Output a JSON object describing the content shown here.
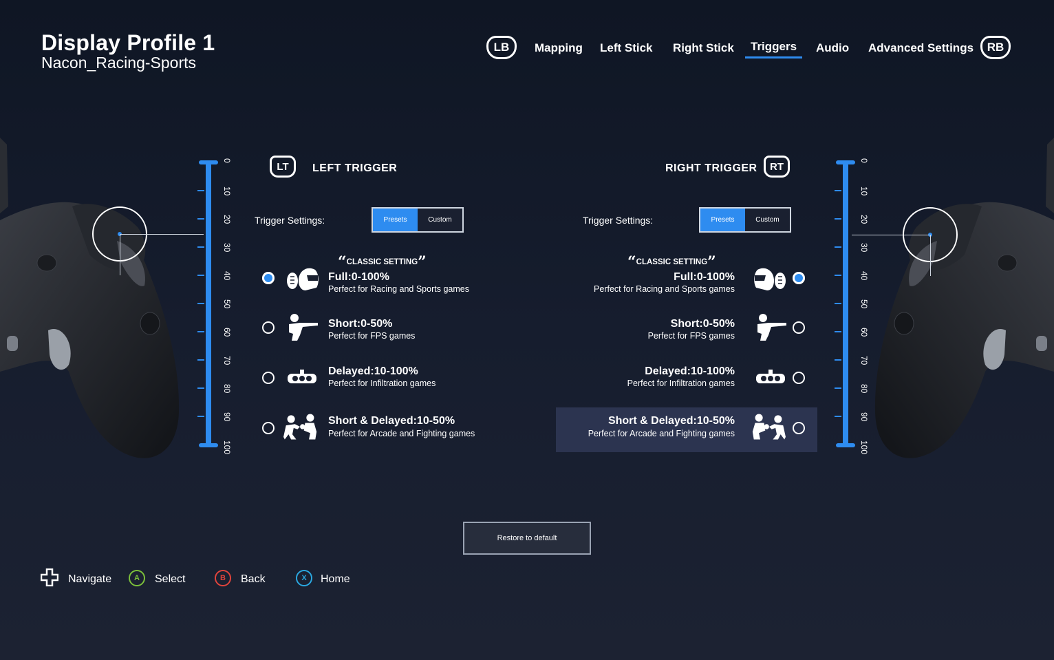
{
  "header": {
    "title": "Display Profile 1",
    "subtitle": "Nacon_Racing-Sports",
    "lb": "LB",
    "rb": "RB",
    "tabs": [
      {
        "label": "Mapping"
      },
      {
        "label": "Left Stick"
      },
      {
        "label": "Right Stick"
      },
      {
        "label": "Triggers",
        "active": true
      },
      {
        "label": "Audio"
      },
      {
        "label": "Advanced Settings"
      }
    ]
  },
  "scale": {
    "ticks": [
      "0",
      "10",
      "20",
      "30",
      "40",
      "50",
      "60",
      "70",
      "80",
      "90",
      "100"
    ]
  },
  "left_trigger": {
    "badge": "LT",
    "title": "LEFT TRIGGER",
    "settings_label": "Trigger Settings:",
    "presets": "Presets",
    "custom": "Custom",
    "classic": "CLASSIC SETTING",
    "options": [
      {
        "title": "Full:0-100%",
        "desc": "Perfect for Racing and Sports games",
        "selected": true,
        "icon": "helmet-football-icon"
      },
      {
        "title": "Short:0-50%",
        "desc": "Perfect for FPS games",
        "selected": false,
        "icon": "soldier-rifle-icon"
      },
      {
        "title": "Delayed:10-100%",
        "desc": "Perfect for Infiltration games",
        "selected": false,
        "icon": "night-vision-goggles-icon"
      },
      {
        "title": "Short  & Delayed:10-50%",
        "desc": "Perfect for Arcade and Fighting games",
        "selected": false,
        "icon": "fighters-icon"
      }
    ]
  },
  "right_trigger": {
    "badge": "RT",
    "title": "RIGHT TRIGGER",
    "settings_label": "Trigger Settings:",
    "presets": "Presets",
    "custom": "Custom",
    "classic": "CLASSIC SETTING",
    "options": [
      {
        "title": "Full:0-100%",
        "desc": "Perfect for Racing and Sports games",
        "selected": true,
        "icon": "helmet-football-icon"
      },
      {
        "title": "Short:0-50%",
        "desc": "Perfect for FPS games",
        "selected": false,
        "icon": "soldier-rifle-icon"
      },
      {
        "title": "Delayed:10-100%",
        "desc": "Perfect for Infiltration games",
        "selected": false,
        "icon": "night-vision-goggles-icon"
      },
      {
        "title": "Short  & Delayed:10-50%",
        "desc": "Perfect for Arcade and Fighting games",
        "selected": false,
        "icon": "fighters-icon",
        "focused": true
      }
    ]
  },
  "restore_label": "Restore to default",
  "footer": {
    "navigate": "Navigate",
    "select": "Select",
    "back": "Back",
    "home": "Home",
    "a": "A",
    "b": "B",
    "x": "X"
  },
  "colors": {
    "accent": "#2e8cf0",
    "a_button": "#7bbf3a",
    "b_button": "#e0443c",
    "x_button": "#2aa8e0"
  }
}
